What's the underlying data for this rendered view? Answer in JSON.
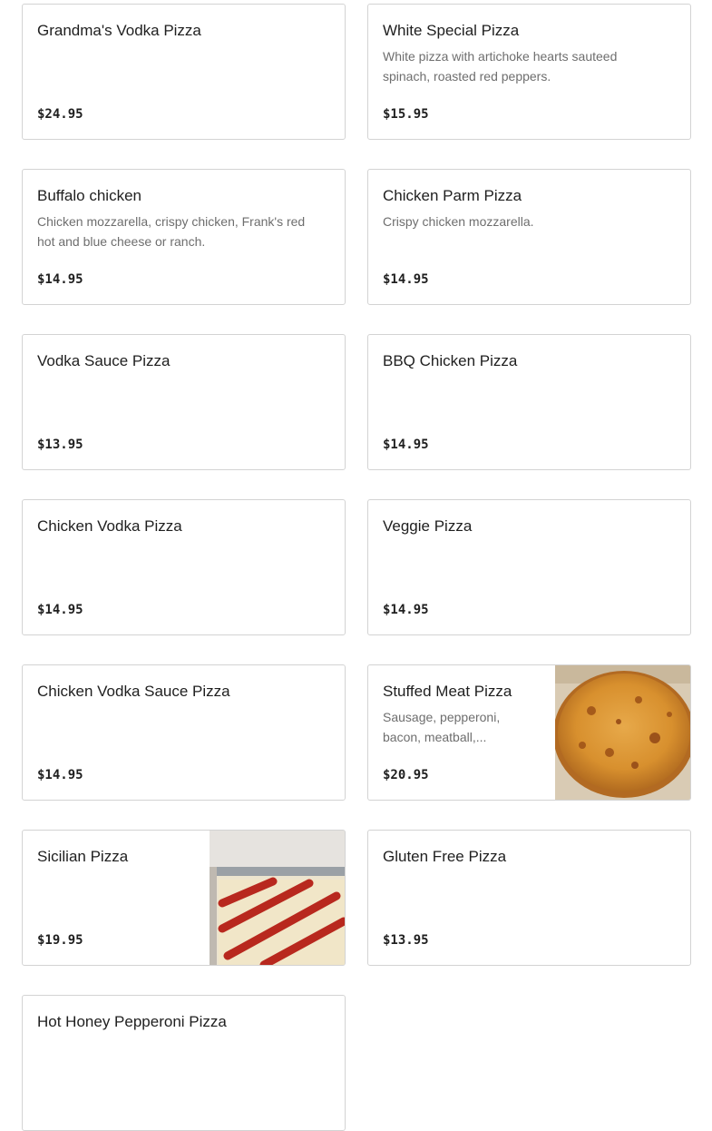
{
  "menu": {
    "items": [
      {
        "name": "Grandma's Vodka Pizza",
        "description": "",
        "price": "$24.95"
      },
      {
        "name": "White Special Pizza",
        "description": "White pizza with artichoke hearts sauteed spinach, roasted red peppers.",
        "price": "$15.95"
      },
      {
        "name": "Buffalo chicken",
        "description": "Chicken mozzarella, crispy chicken, Frank's red hot and blue cheese or ranch.",
        "price": "$14.95"
      },
      {
        "name": "Chicken Parm Pizza",
        "description": "Crispy chicken mozzarella.",
        "price": "$14.95"
      },
      {
        "name": "Vodka Sauce Pizza",
        "description": "",
        "price": "$13.95"
      },
      {
        "name": "BBQ Chicken Pizza",
        "description": "",
        "price": "$14.95"
      },
      {
        "name": "Chicken Vodka Pizza",
        "description": "",
        "price": "$14.95"
      },
      {
        "name": "Veggie Pizza",
        "description": "",
        "price": "$14.95"
      },
      {
        "name": "Chicken Vodka Sauce Pizza",
        "description": "",
        "price": "$14.95"
      },
      {
        "name": "Stuffed Meat Pizza",
        "description": "Sausage, pepperoni, bacon, meatball,...",
        "price": "$20.95"
      },
      {
        "name": "Sicilian Pizza",
        "description": "",
        "price": "$19.95"
      },
      {
        "name": "Gluten Free Pizza",
        "description": "",
        "price": "$13.95"
      },
      {
        "name": "Hot Honey Pepperoni Pizza",
        "description": "",
        "price": ""
      }
    ]
  }
}
